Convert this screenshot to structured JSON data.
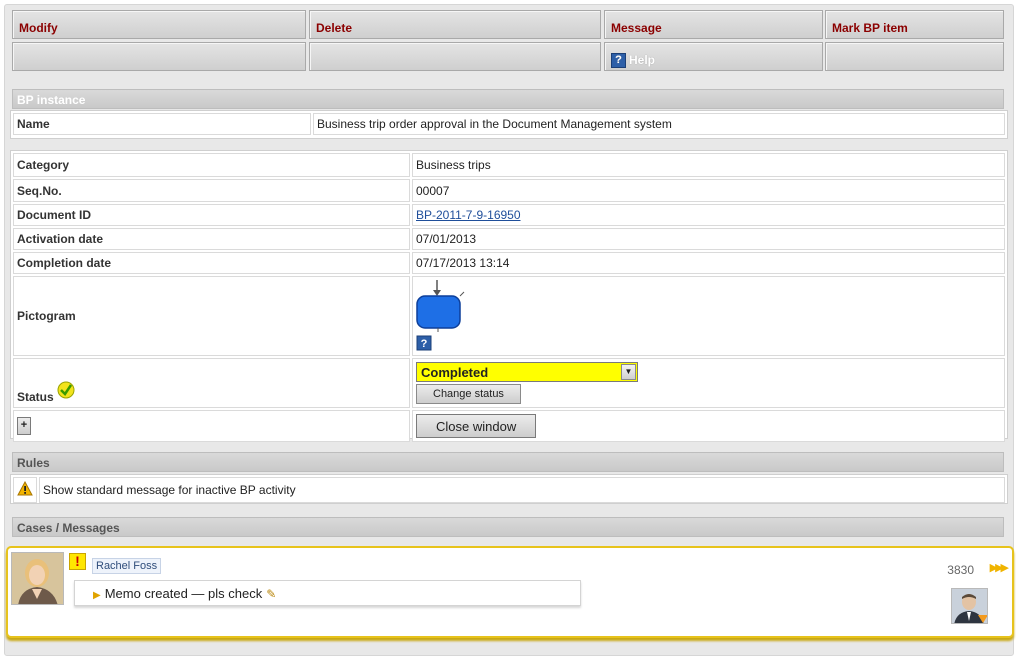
{
  "toolbar": {
    "modify": "Modify",
    "delete": "Delete",
    "message": "Message",
    "mark_bp_item": "Mark BP item",
    "help": "Help"
  },
  "bp_instance": {
    "header": "BP instance",
    "name_label": "Name",
    "name_value": "Business trip order approval in the Document Management system"
  },
  "details": {
    "category_label": "Category",
    "category_value": "Business trips",
    "seq_label": "Seq.No.",
    "seq_value": "00007",
    "docid_label": "Document ID",
    "docid_value": "BP-2011-7-9-16950",
    "activation_label": "Activation date",
    "activation_value": "07/01/2013",
    "completion_label": "Completion date",
    "completion_value": "07/17/2013 13:14",
    "pictogram_label": "Pictogram",
    "status_label": "Status",
    "status_value": "Completed",
    "change_status": "Change status",
    "plus": "+",
    "close_window": "Close window"
  },
  "rules": {
    "header": "Rules",
    "item": "Show standard message for inactive BP activity"
  },
  "cases": {
    "header": "Cases / Messages",
    "author": "Rachel Foss",
    "memo": "Memo created — pls check",
    "number": "3830"
  },
  "colors": {
    "toolbar_text": "#8b0000",
    "status_bg": "#ffff00",
    "card_border": "#e7c31c",
    "pictogram": "#1e6fe6"
  },
  "icons": [
    "help-icon",
    "warning-icon",
    "check-icon",
    "exclamation-icon",
    "pencil-icon",
    "arrows-right-icon",
    "dropdown-arrow-icon"
  ]
}
